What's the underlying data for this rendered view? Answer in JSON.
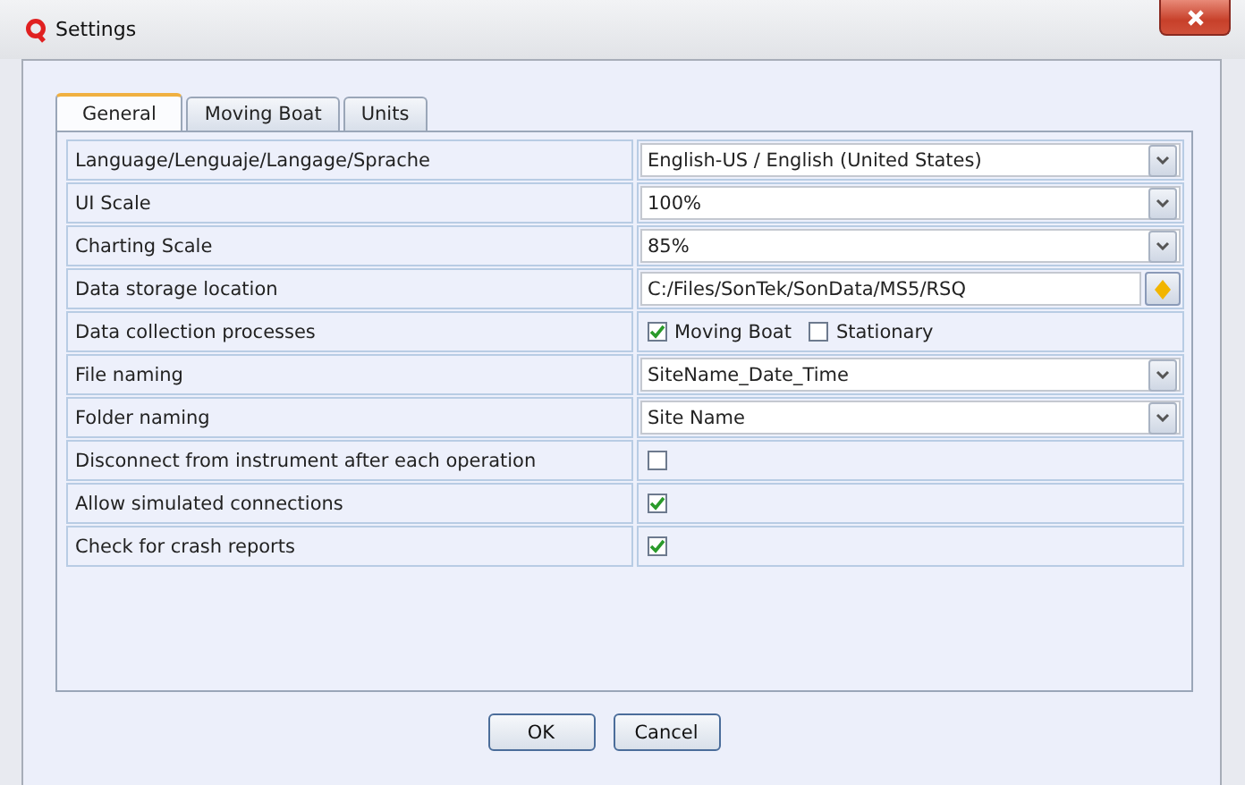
{
  "window": {
    "title": "Settings"
  },
  "tabs": [
    {
      "label": "General",
      "selected": true
    },
    {
      "label": "Moving Boat",
      "selected": false
    },
    {
      "label": "Units",
      "selected": false
    }
  ],
  "rows": [
    {
      "label": "Language/Lenguaje/Langage/Sprache",
      "kind": "select",
      "value": "English-US / English (United States)"
    },
    {
      "label": "UI Scale",
      "kind": "select",
      "value": "100%"
    },
    {
      "label": "Charting Scale",
      "kind": "select",
      "value": "85%"
    },
    {
      "label": "Data storage location",
      "kind": "path",
      "value": "C:/Files/SonTek/SonData/MS5/RSQ"
    },
    {
      "label": "Data collection processes",
      "kind": "options",
      "options": [
        {
          "label": "Moving Boat",
          "checked": true
        },
        {
          "label": "Stationary",
          "checked": false
        }
      ]
    },
    {
      "label": "File naming",
      "kind": "select",
      "value": "SiteName_Date_Time"
    },
    {
      "label": "Folder naming",
      "kind": "select",
      "value": "Site Name"
    },
    {
      "label": "Disconnect from instrument after each operation",
      "kind": "checkbox",
      "checked": false
    },
    {
      "label": "Allow simulated connections",
      "kind": "checkbox",
      "checked": true
    },
    {
      "label": "Check for crash reports",
      "kind": "checkbox",
      "checked": true
    }
  ],
  "buttons": [
    "OK",
    "Cancel"
  ]
}
